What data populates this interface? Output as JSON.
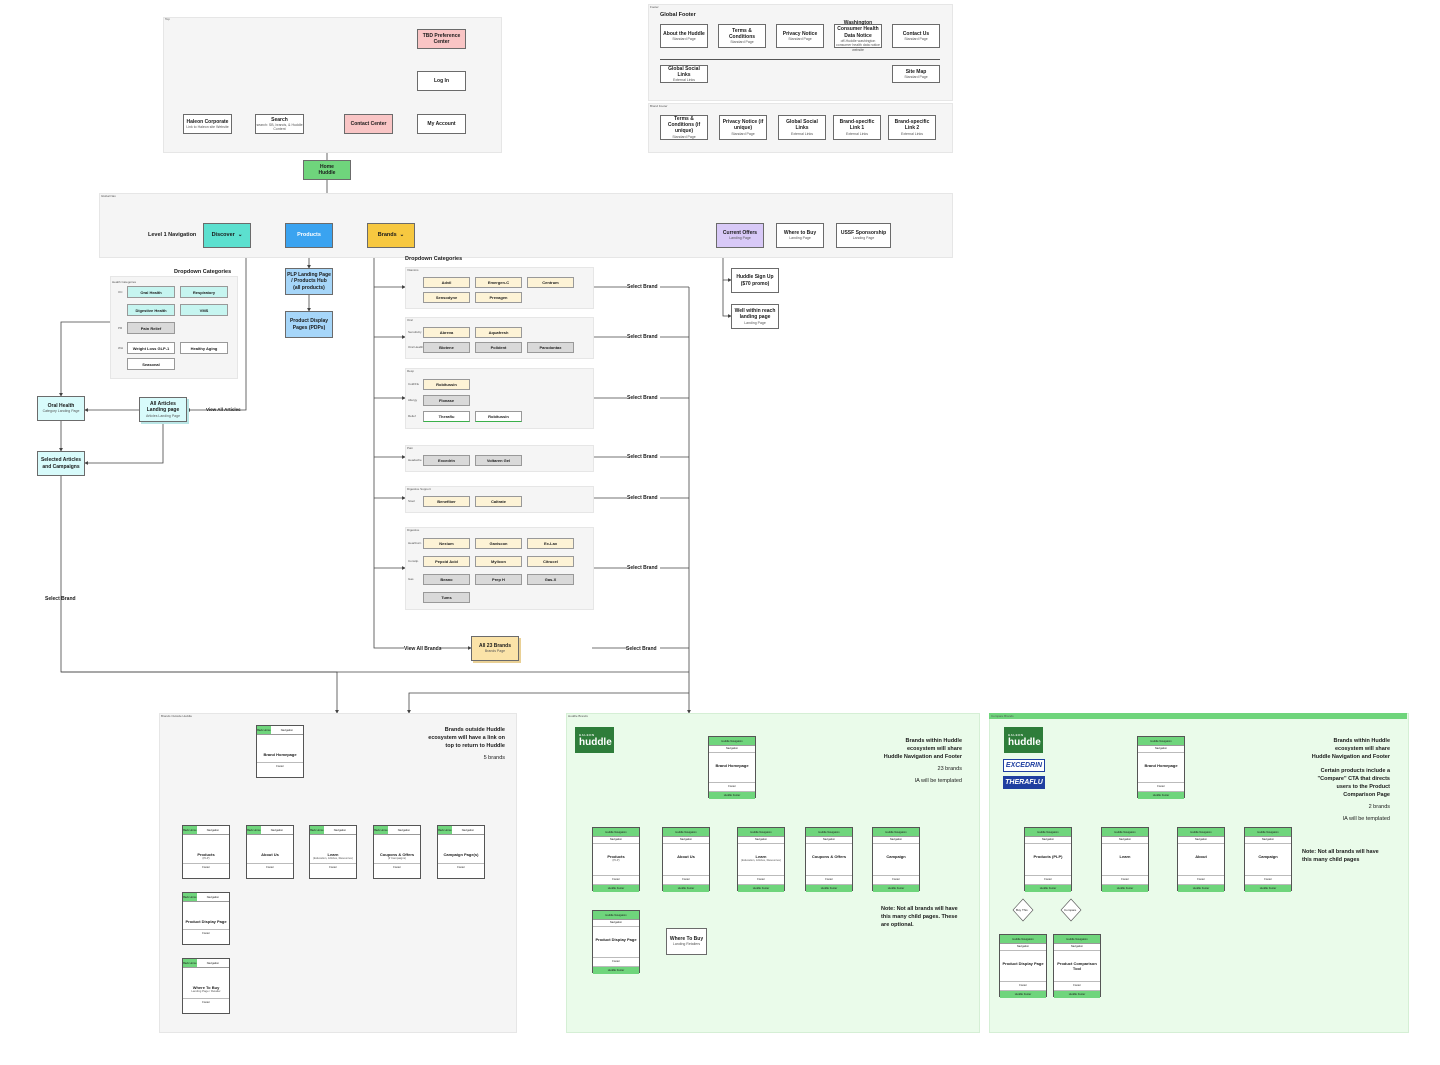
{
  "top_nav": {
    "section_label": "Top",
    "boxes": {
      "haleon": {
        "title": "Haleon Corporate",
        "sub": "Link to Haleon site Website"
      },
      "search": {
        "title": "Search",
        "sub": "search: SB, brands, & Huddle Content"
      },
      "contact": {
        "title": "Contact Center",
        "sub": ""
      },
      "account": {
        "title": "My Account",
        "sub": ""
      },
      "login": {
        "title": "Log In",
        "sub": ""
      },
      "tbd": {
        "title": "TBD Preference Center",
        "sub": ""
      }
    }
  },
  "footer": {
    "title": "Global Footer",
    "section_label": "Footer",
    "row1": [
      {
        "title": "About the Huddle",
        "sub": "Standard Page"
      },
      {
        "title": "Terms & Conditions",
        "sub": "Standard Page"
      },
      {
        "title": "Privacy Notice",
        "sub": "Standard Page"
      },
      {
        "title": "Washington Consumer Health Data Notice",
        "sub": "off-Huddle washington consumer health data notice website"
      },
      {
        "title": "Contact Us",
        "sub": "Standard Page"
      }
    ],
    "row2": [
      {
        "title": "Global Social Links",
        "sub": "External Links"
      },
      {
        "title": "Site Map",
        "sub": "Standard Page"
      }
    ],
    "brand_label": "Brand Footer",
    "row3": [
      {
        "title": "Terms & Conditions (if unique)",
        "sub": "Standard Page"
      },
      {
        "title": "Privacy Notice (if unique)",
        "sub": "Standard Page"
      },
      {
        "title": "Global Social Links",
        "sub": "External Links"
      },
      {
        "title": "Brand-specific Link 1",
        "sub": "External Links"
      },
      {
        "title": "Brand-specific Link 2",
        "sub": "External Links"
      }
    ]
  },
  "home": {
    "title": "Home",
    "sub": "Huddle"
  },
  "level1": {
    "section_label": "Global Nav",
    "label": "Level 1 Navigation",
    "discover": "Discover",
    "products": "Products",
    "brands": "Brands",
    "current_offers": {
      "title": "Current Offers",
      "sub": "Landing Page"
    },
    "where_to_buy": {
      "title": "Where to Buy",
      "sub": "Landing Page"
    },
    "ussf": {
      "title": "USSF Sponsorship",
      "sub": "Landing Page"
    }
  },
  "offers": {
    "signup": {
      "title": "Huddle Sign Up ($70 promo)",
      "sub": ""
    },
    "wellwithin": {
      "title": "Well within reach landing page",
      "sub": "Landing Page"
    }
  },
  "discover": {
    "title": "Dropdown Categories",
    "header": "Health Categories",
    "row_labels": [
      "OC",
      "PR",
      "WH"
    ],
    "chips": [
      "Oral Health",
      "Respiratory",
      "Digestive Health",
      "VMS",
      "Pain Relief",
      "Weight Loss GLP-1",
      "Healthy Aging",
      "Seasonal"
    ],
    "view_all": "View All Articles",
    "all_articles": {
      "title": "All Articles Landing page",
      "sub": "Articles Landing Page"
    },
    "oral_health": {
      "title": "Oral Health",
      "sub": "Category Landing Page"
    },
    "selected": {
      "title": "Selected Articles and Campaigns",
      "sub": ""
    },
    "select_brand": "Select Brand"
  },
  "products": {
    "plp": {
      "title": "PLP Landing Page / Products Hub",
      "sub": "(all products)"
    },
    "pdp": {
      "title": "Product Display Pages (PDPs)",
      "sub": ""
    }
  },
  "brands": {
    "title": "Dropdown Categories",
    "select_brand": "Select Brand",
    "view_all": "View All Brands",
    "all_brands": {
      "title": "All 23 Brands",
      "sub": "Brands Page"
    },
    "groups": [
      {
        "cat": "Vitamins",
        "left_tags": [],
        "chips": [
          [
            "Advil",
            "cream"
          ],
          [
            "Emergen-C",
            "cream"
          ],
          [
            "Centrum",
            "cream"
          ],
          [
            "Sensodyne",
            "cream"
          ],
          [
            "Prevagen",
            "cream"
          ]
        ]
      },
      {
        "cat": "Oral",
        "left_tags": [
          "Sensitivity",
          "Oral Health"
        ],
        "chips": [
          [
            "Abreva",
            "cream"
          ],
          [
            "Aquafresh",
            "cream"
          ],
          [
            "Biotene",
            "grey"
          ],
          [
            "Polident",
            "grey"
          ],
          [
            "Parodontax",
            "grey"
          ]
        ]
      },
      {
        "cat": "Resp",
        "left_tags": [
          "Cold/Flu",
          "Allergy",
          "Relief"
        ],
        "chips": [
          [
            "Robitussin",
            "cream"
          ],
          [
            "Flonase",
            "grey"
          ],
          [
            "Theraflu",
            "white"
          ],
          [
            "Robitussin",
            "white"
          ]
        ]
      },
      {
        "cat": "Pain",
        "left_tags": [
          "Headache"
        ],
        "chips": [
          [
            "Excedrin",
            "grey"
          ],
          [
            "Voltaren Gel",
            "grey"
          ]
        ]
      },
      {
        "cat": "Digestive Support",
        "left_tags": [
          "Stool"
        ],
        "chips": [
          [
            "Benefiber",
            "cream"
          ],
          [
            "Caltrate",
            "cream"
          ]
        ]
      },
      {
        "cat": "Digestive",
        "left_tags": [
          "Heartburn",
          "Constip.",
          "Gas"
        ],
        "chips": [
          [
            "Nexium",
            "cream"
          ],
          [
            "Gaviscon",
            "cream"
          ],
          [
            "Ex-Lax",
            "cream"
          ],
          [
            "Pepcid Acid",
            "cream"
          ],
          [
            "Mylicon",
            "cream"
          ],
          [
            "Citrucel",
            "cream"
          ],
          [
            "Beano",
            "grey"
          ],
          [
            "Prep H",
            "grey"
          ],
          [
            "Gas-X",
            "grey"
          ],
          [
            "Tums",
            "grey"
          ]
        ]
      }
    ]
  },
  "diag1": {
    "section_label": "Brands Outside Huddle",
    "note": [
      "Brands outside Huddle",
      "ecosystem will have a link on",
      "top to return to Huddle"
    ],
    "count": "5 brands",
    "home": {
      "title": "Brand Homepage",
      "sub": ""
    },
    "children": [
      {
        "title": "Products",
        "sub": "(PLP)"
      },
      {
        "title": "About Us",
        "sub": ""
      },
      {
        "title": "Learn",
        "sub": "(Education, Articles, Resources)"
      },
      {
        "title": "Coupons & Offers",
        "sub": "(if Campaigns)"
      },
      {
        "title": "Campaign Page(s)",
        "sub": ""
      }
    ],
    "pdp": {
      "title": "Product Display Page",
      "sub": ""
    },
    "wtb": {
      "title": "Where To Buy",
      "sub": "Landing Page / Retailer"
    },
    "tag_home": "Back Home",
    "tag_nav": "Navigation",
    "footer": "Footer"
  },
  "diag2": {
    "section_label": "Huddle Brands",
    "logo_small": "HALEON",
    "logo_big": "huddle",
    "note": [
      "Brands within Huddle",
      "ecosystem will share",
      "Huddle Navigation and Footer"
    ],
    "count": "23 brands",
    "templated": "IA will be templated",
    "note2": [
      "Note: Not all brands will have",
      "this many child pages. These",
      "are optional."
    ],
    "home": {
      "title": "Brand Homepage",
      "sub": ""
    },
    "children": [
      {
        "title": "Products",
        "sub": "(PLP)"
      },
      {
        "title": "About Us",
        "sub": ""
      },
      {
        "title": "Learn",
        "sub": "(Education, Articles, Resources)"
      },
      {
        "title": "Coupons & Offers",
        "sub": ""
      },
      {
        "title": "Campaign",
        "sub": ""
      }
    ],
    "pdp": {
      "title": "Product Display Page",
      "sub": ""
    },
    "wtb": {
      "title": "Where To Buy",
      "sub": "Landing Retailers"
    },
    "tag_huddle": "Huddle Navigation",
    "tag_nav": "Navigation",
    "footer": "Footer",
    "huddle_footer": "Huddle Footer"
  },
  "diag3": {
    "section_label": "Compare Brands",
    "logo_small": "HALEON",
    "logo_big": "huddle",
    "brand1": "EXCEDRIN",
    "brand2": "THERAFLU",
    "note": [
      "Brands within Huddle",
      "ecosystem will share",
      "Huddle Navigation and Footer"
    ],
    "note_b": [
      "Certain products include a",
      "\"Compare\" CTA that directs",
      "users to the Product",
      "Comparison Page"
    ],
    "count": "2 brands",
    "templated": "IA will be templated",
    "note2": [
      "Note: Not all brands will have",
      "this many child pages"
    ],
    "home": {
      "title": "Brand Homepage",
      "sub": ""
    },
    "children": [
      {
        "title": "Products (PLP)",
        "sub": ""
      },
      {
        "title": "Learn",
        "sub": ""
      },
      {
        "title": "About",
        "sub": ""
      },
      {
        "title": "Campaign",
        "sub": ""
      }
    ],
    "diamond1": "Buy This",
    "diamond2": "Compare",
    "pdp": {
      "title": "Product Display Page",
      "sub": ""
    },
    "compare": {
      "title": "Product Comparison Tool",
      "sub": ""
    },
    "tag_huddle": "Huddle Navigation",
    "tag_nav": "Navigation",
    "footer": "Footer",
    "huddle_footer": "Huddle Footer"
  }
}
